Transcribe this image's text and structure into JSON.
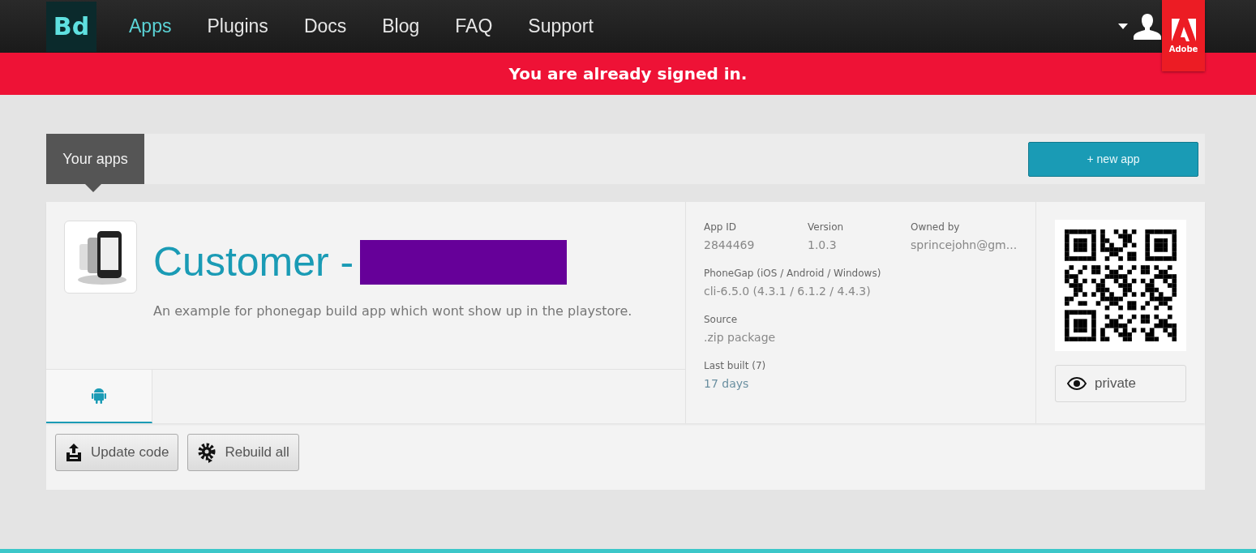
{
  "logo": {
    "text": "Bd"
  },
  "nav": [
    {
      "label": "Apps",
      "selected": true
    },
    {
      "label": "Plugins",
      "selected": false
    },
    {
      "label": "Docs",
      "selected": false
    },
    {
      "label": "Blog",
      "selected": false
    },
    {
      "label": "FAQ",
      "selected": false
    },
    {
      "label": "Support",
      "selected": false
    }
  ],
  "adobe_badge": {
    "text": "Adobe"
  },
  "banner": {
    "message": "You are already signed in."
  },
  "section_tab": {
    "label": "Your apps"
  },
  "new_app_button": {
    "label": "+ new app"
  },
  "app": {
    "title": "Customer -",
    "redacted": true,
    "description": "An example for phonegap build app which wont show up in the playstore.",
    "platforms": [
      {
        "kind": "android",
        "selected": true
      }
    ],
    "details": [
      {
        "label": "App ID",
        "value": "2844469"
      },
      {
        "label": "Version",
        "value": "1.0.3"
      },
      {
        "label": "Owned by",
        "value": "sprincejohn@gm..."
      },
      {
        "label": "PhoneGap (iOS / Android / Windows)",
        "value": "cli-6.5.0 (4.3.1 / 6.1.2 / 4.4.3)"
      },
      {
        "label": "Source",
        "value": ".zip package"
      },
      {
        "label": "Last built (7)",
        "value": "17 days"
      }
    ],
    "privacy_button": {
      "label": "private"
    },
    "actions": [
      {
        "kind": "upload",
        "label": "Update code"
      },
      {
        "kind": "rebuild",
        "label": "Rebuild all"
      }
    ]
  }
}
